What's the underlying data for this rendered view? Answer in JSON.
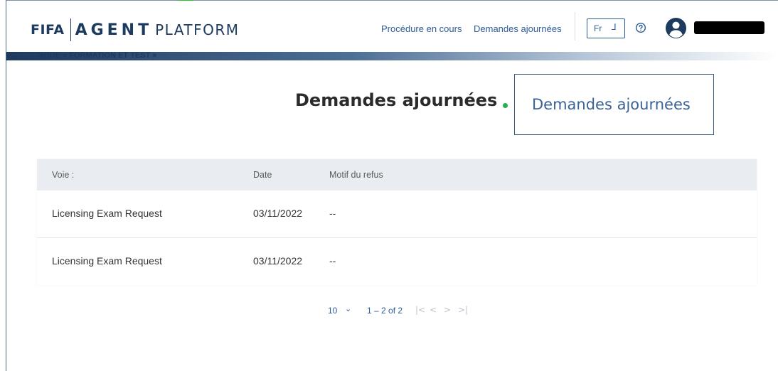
{
  "header": {
    "logo_fifa": "FIFA",
    "logo_agent": "AGENT",
    "logo_platform": "PLATFORM",
    "nav": [
      "Procédure en cours",
      "Demandes ajournées"
    ],
    "language": "Fr",
    "icons": {
      "language": "language-select-icon",
      "help": "help-circle-icon",
      "avatar": "user-avatar-icon"
    }
  },
  "mode_banner": "MODE « FORMATION ET TEST »",
  "page": {
    "title": "Demandes ajournées",
    "tooltip": "Demandes ajournées"
  },
  "table": {
    "headers": [
      "Voie :",
      "Date",
      "Motif du refus"
    ],
    "rows": [
      [
        "Licensing Exam Request",
        "03/11/2022",
        "--"
      ],
      [
        "Licensing Exam Request",
        "03/11/2022",
        "--"
      ]
    ]
  },
  "pagination": {
    "page_size": "10",
    "range": "1 – 2 of 2",
    "first": "|<",
    "prev": "<",
    "next": ">",
    "last": ">|"
  },
  "colors": {
    "brand_navy": "#1d3a5f",
    "link_blue": "#2c5b96",
    "accent_green": "#22b14c",
    "header_row_bg": "#e9edf1"
  }
}
